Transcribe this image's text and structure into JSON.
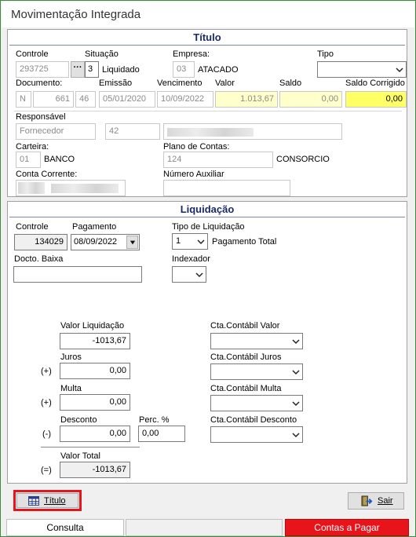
{
  "window": {
    "title": "Movimentação Integrada"
  },
  "titulo": {
    "header": "Título",
    "controle_label": "Controle",
    "controle_value": "293725",
    "situacao_label": "Situação",
    "situacao_code": "3",
    "situacao_text": "Liquidado",
    "empresa_label": "Empresa:",
    "empresa_code": "03",
    "empresa_name": "ATACADO",
    "tipo_label": "Tipo",
    "tipo_value": "",
    "documento_label": "Documento:",
    "doc_type": "N",
    "doc_number": "661",
    "doc_parcel": "46",
    "emissao_label": "Emissão",
    "emissao_value": "05/01/2020",
    "vencimento_label": "Vencimento",
    "vencimento_value": "10/09/2022",
    "valor_label": "Valor",
    "valor_value": "1.013,67",
    "saldo_label": "Saldo",
    "saldo_value": "0,00",
    "saldo_corrigido_label": "Saldo Corrigido",
    "saldo_corrigido_value": "0,00",
    "responsavel_label": "Responsável",
    "responsavel_type": "Fornecedor",
    "responsavel_code": "42",
    "carteira_label": "Carteira:",
    "carteira_code": "01",
    "carteira_name": "BANCO",
    "plano_label": "Plano de Contas:",
    "plano_code": "124",
    "plano_name": "CONSORCIO",
    "conta_corrente_label": "Conta Corrente:",
    "numero_auxiliar_label": "Número Auxiliar",
    "numero_auxiliar_value": ""
  },
  "liquidacao": {
    "header": "Liquidação",
    "controle_label": "Controle",
    "controle_value": "134029",
    "pagamento_label": "Pagamento",
    "pagamento_value": "08/09/2022",
    "tipo_label": "Tipo de Liquidação",
    "tipo_code": "1",
    "tipo_text": "Pagamento Total",
    "docto_baixa_label": "Docto. Baixa",
    "docto_baixa_value": "",
    "indexador_label": "Indexador",
    "indexador_value": "",
    "valor_liq_label": "Valor Liquidação",
    "valor_liq_value": "-1013,67",
    "juros_label": "Juros",
    "juros_sign": "(+)",
    "juros_value": "0,00",
    "multa_label": "Multa",
    "multa_sign": "(+)",
    "multa_value": "0,00",
    "desconto_label": "Desconto",
    "desconto_sign": "(-)",
    "desconto_value": "0,00",
    "perc_label": "Perc. %",
    "perc_value": "0,00",
    "valor_total_label": "Valor Total",
    "valor_total_sign": "(=)",
    "valor_total_value": "-1013,67",
    "cta_valor_label": "Cta.Contábil Valor",
    "cta_juros_label": "Cta.Contábil Juros",
    "cta_multa_label": "Cta.Contábil Multa",
    "cta_desconto_label": "Cta.Contábil Desconto"
  },
  "buttons": {
    "titulo": "Título",
    "sair": "Sair"
  },
  "tabs": {
    "consulta": "Consulta",
    "middle": "",
    "contas_pagar": "Contas a Pagar"
  },
  "colors": {
    "highlight_border": "#e8141b",
    "active_tab": "#e8141b",
    "section_title": "#1a2a6a",
    "yellow_field": "#ffff66"
  }
}
